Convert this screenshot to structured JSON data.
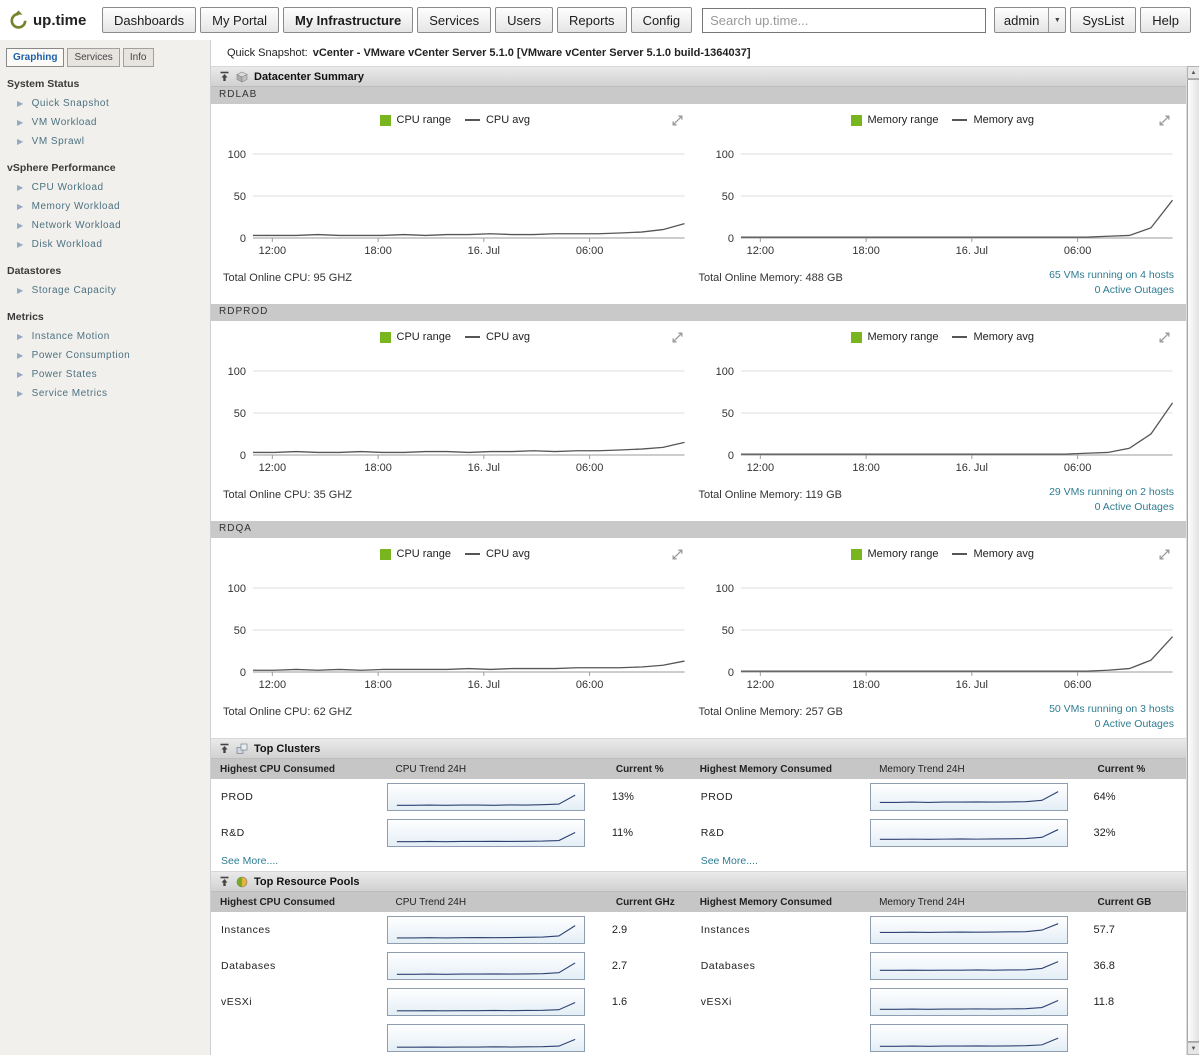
{
  "header": {
    "logo_text": "up.time",
    "nav_items": [
      {
        "label": "Dashboards",
        "active": false
      },
      {
        "label": "My Portal",
        "active": false
      },
      {
        "label": "My Infrastructure",
        "active": true
      },
      {
        "label": "Services",
        "active": false
      },
      {
        "label": "Users",
        "active": false
      },
      {
        "label": "Reports",
        "active": false
      },
      {
        "label": "Config",
        "active": false
      }
    ],
    "search_placeholder": "Search up.time...",
    "user_button": "admin",
    "syslist_button": "SysList",
    "help_button": "Help"
  },
  "subheader": {
    "label": "Quick Snapshot:",
    "value": "vCenter - VMware vCenter Server 5.1.0 [VMware vCenter Server 5.1.0 build-1364037]"
  },
  "sidebar": {
    "tabs": [
      {
        "label": "Graphing",
        "active": true
      },
      {
        "label": "Services",
        "active": false
      },
      {
        "label": "Info",
        "active": false
      }
    ],
    "sections": [
      {
        "title": "System Status",
        "items": [
          "Quick Snapshot",
          "VM Workload",
          "VM Sprawl"
        ]
      },
      {
        "title": "vSphere Performance",
        "items": [
          "CPU Workload",
          "Memory Workload",
          "Network Workload",
          "Disk Workload"
        ]
      },
      {
        "title": "Datastores",
        "items": [
          "Storage Capacity"
        ]
      },
      {
        "title": "Metrics",
        "items": [
          "Instance Motion",
          "Power Consumption",
          "Power States",
          "Service Metrics"
        ]
      }
    ]
  },
  "datacenter_summary": {
    "title": "Datacenter Summary",
    "axis": {
      "y_ticks": [
        "100",
        "50",
        "0"
      ],
      "x_ticks": [
        "12:00",
        "18:00",
        "16. Jul",
        "06:00"
      ]
    },
    "cpu_legend": {
      "range": "CPU range",
      "avg": "CPU avg"
    },
    "memory_legend": {
      "range": "Memory range",
      "avg": "Memory avg"
    },
    "datacenters": [
      {
        "name": "RDLAB",
        "cpu_total": "Total Online CPU: 95 GHZ",
        "memory_total": "Total Online Memory: 488 GB",
        "vms_line": "65 VMs running on 4 hosts",
        "outages_line": "0 Active Outages",
        "cpu_avg": [
          3,
          3,
          3,
          4,
          3,
          3,
          3,
          4,
          3,
          4,
          4,
          5,
          4,
          4,
          5,
          5,
          5,
          6,
          7,
          10,
          17
        ],
        "memory_avg": [
          1,
          1,
          1,
          1,
          1,
          1,
          1,
          1,
          1,
          1,
          1,
          1,
          1,
          1,
          1,
          1,
          1,
          2,
          3,
          12,
          45
        ]
      },
      {
        "name": "RDPROD",
        "cpu_total": "Total Online CPU: 35 GHZ",
        "memory_total": "Total Online Memory: 119 GB",
        "vms_line": "29 VMs running on 2 hosts",
        "outages_line": "0 Active Outages",
        "cpu_avg": [
          3,
          3,
          4,
          3,
          3,
          4,
          3,
          3,
          4,
          4,
          3,
          4,
          4,
          5,
          4,
          5,
          5,
          6,
          7,
          9,
          15
        ],
        "memory_avg": [
          1,
          1,
          1,
          1,
          1,
          1,
          1,
          1,
          1,
          1,
          1,
          1,
          1,
          1,
          1,
          1,
          2,
          3,
          8,
          25,
          62
        ]
      },
      {
        "name": "RDQA",
        "cpu_total": "Total Online CPU: 62 GHZ",
        "memory_total": "Total Online Memory: 257 GB",
        "vms_line": "50 VMs running on 3 hosts",
        "outages_line": "0 Active Outages",
        "cpu_avg": [
          2,
          2,
          3,
          2,
          3,
          2,
          3,
          3,
          3,
          3,
          4,
          3,
          4,
          4,
          4,
          5,
          5,
          5,
          6,
          8,
          13
        ],
        "memory_avg": [
          1,
          1,
          1,
          1,
          1,
          1,
          1,
          1,
          1,
          1,
          1,
          1,
          1,
          1,
          1,
          1,
          1,
          2,
          4,
          14,
          42
        ]
      }
    ]
  },
  "top_clusters": {
    "title": "Top Clusters",
    "columns": [
      "Highest CPU Consumed",
      "CPU Trend 24H",
      "Current %",
      "Highest Memory Consumed",
      "Memory Trend 24H",
      "Current %"
    ],
    "see_more": "See More....",
    "rows": [
      {
        "cpu_name": "PROD",
        "cpu_trend": [
          10,
          10,
          11,
          10,
          11,
          11,
          10,
          12,
          11,
          13,
          16,
          62
        ],
        "cpu_value": "13%",
        "mem_name": "PROD",
        "mem_trend": [
          25,
          25,
          26,
          25,
          26,
          26,
          27,
          26,
          27,
          28,
          35,
          80
        ],
        "mem_value": "64%"
      },
      {
        "cpu_name": "R&D",
        "cpu_trend": [
          8,
          8,
          9,
          8,
          9,
          9,
          10,
          9,
          10,
          11,
          14,
          55
        ],
        "cpu_value": "11%",
        "mem_name": "R&D",
        "mem_trend": [
          20,
          20,
          21,
          20,
          21,
          22,
          21,
          22,
          23,
          24,
          30,
          70
        ],
        "mem_value": "32%"
      }
    ]
  },
  "top_resource_pools": {
    "title": "Top Resource Pools",
    "columns": [
      "Highest CPU Consumed",
      "CPU Trend 24H",
      "Current GHz",
      "Highest Memory Consumed",
      "Memory Trend 24H",
      "Current GB"
    ],
    "rows": [
      {
        "cpu_name": "Instances",
        "cpu_trend": [
          12,
          12,
          13,
          12,
          13,
          14,
          13,
          14,
          15,
          16,
          22,
          75
        ],
        "cpu_value": "2.9",
        "mem_name": "Instances",
        "mem_trend": [
          40,
          40,
          41,
          40,
          41,
          42,
          41,
          42,
          43,
          44,
          52,
          85
        ],
        "mem_value": "57.7"
      },
      {
        "cpu_name": "Databases",
        "cpu_trend": [
          10,
          10,
          11,
          10,
          11,
          11,
          12,
          11,
          12,
          13,
          18,
          68
        ],
        "cpu_value": "2.7",
        "mem_name": "Databases",
        "mem_trend": [
          30,
          30,
          31,
          30,
          31,
          31,
          32,
          31,
          32,
          33,
          40,
          75
        ],
        "mem_value": "36.8"
      },
      {
        "cpu_name": "vESXi",
        "cpu_trend": [
          7,
          7,
          8,
          7,
          8,
          8,
          9,
          8,
          9,
          10,
          13,
          50
        ],
        "cpu_value": "1.6",
        "mem_name": "vESXi",
        "mem_trend": [
          15,
          15,
          16,
          15,
          16,
          16,
          17,
          16,
          17,
          18,
          24,
          60
        ],
        "mem_value": "11.8"
      },
      {
        "cpu_name": "",
        "cpu_trend": [
          5,
          5,
          6,
          5,
          6,
          6,
          7,
          6,
          7,
          8,
          11,
          45
        ],
        "cpu_value": "",
        "mem_name": "",
        "mem_trend": [
          10,
          10,
          11,
          10,
          11,
          11,
          12,
          11,
          12,
          13,
          17,
          52
        ],
        "mem_value": ""
      }
    ]
  }
}
